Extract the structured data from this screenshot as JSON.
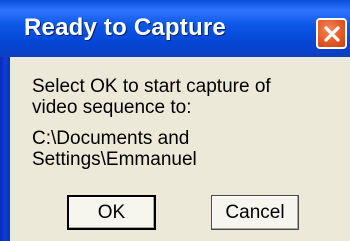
{
  "dialog": {
    "title": "Ready to Capture",
    "message_lines": [
      "Select OK to start capture of",
      "video sequence to:"
    ],
    "path_lines": [
      "C:\\Documents and",
      "Settings\\Emmanuel"
    ],
    "ok_label": "OK",
    "cancel_label": "Cancel"
  },
  "colors": {
    "titlebar": "#0b56e6",
    "close_button": "#e25a27",
    "dialog_background": "#ece9d8"
  },
  "icons": {
    "close": "close-icon"
  }
}
